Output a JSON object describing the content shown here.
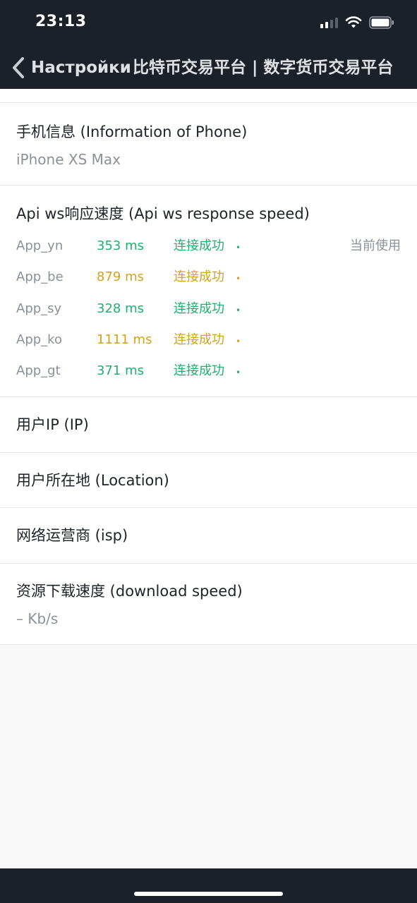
{
  "status_bar": {
    "time": "23:13"
  },
  "nav": {
    "back_label": "Настройки",
    "title": "比特币交易平台 | 数字货币交易平台"
  },
  "phone_info": {
    "title": "手机信息 (Information of Phone)",
    "value": "iPhone XS Max"
  },
  "api_speed": {
    "title": "Api ws响应速度 (Api ws response speed)",
    "rows": [
      {
        "name": "App_yn",
        "ms": "353 ms",
        "status": "连接成功",
        "dot": "•",
        "current": "当前使用",
        "color": "#1fb071"
      },
      {
        "name": "App_be",
        "ms": "879 ms",
        "status": "连接成功",
        "dot": "•",
        "current": "",
        "color": "#d4a21c"
      },
      {
        "name": "App_sy",
        "ms": "328 ms",
        "status": "连接成功",
        "dot": "•",
        "current": "",
        "color": "#1fb071"
      },
      {
        "name": "App_ko",
        "ms": "1111 ms",
        "status": "连接成功",
        "dot": "•",
        "current": "",
        "color": "#d4a21c"
      },
      {
        "name": "App_gt",
        "ms": "371 ms",
        "status": "连接成功",
        "dot": "•",
        "current": "",
        "color": "#1fb071"
      }
    ]
  },
  "user_ip": {
    "title": "用户IP (IP)"
  },
  "location": {
    "title": "用户所在地 (Location)"
  },
  "isp": {
    "title": "网络运营商 (isp)"
  },
  "download": {
    "title": "资源下载速度 (download speed)",
    "value": "– Kb/s"
  },
  "colors": {
    "header_bg": "#1b2029",
    "success_green": "#1fb071",
    "warning_orange": "#d4a21c",
    "muted_text": "#8b9099"
  }
}
